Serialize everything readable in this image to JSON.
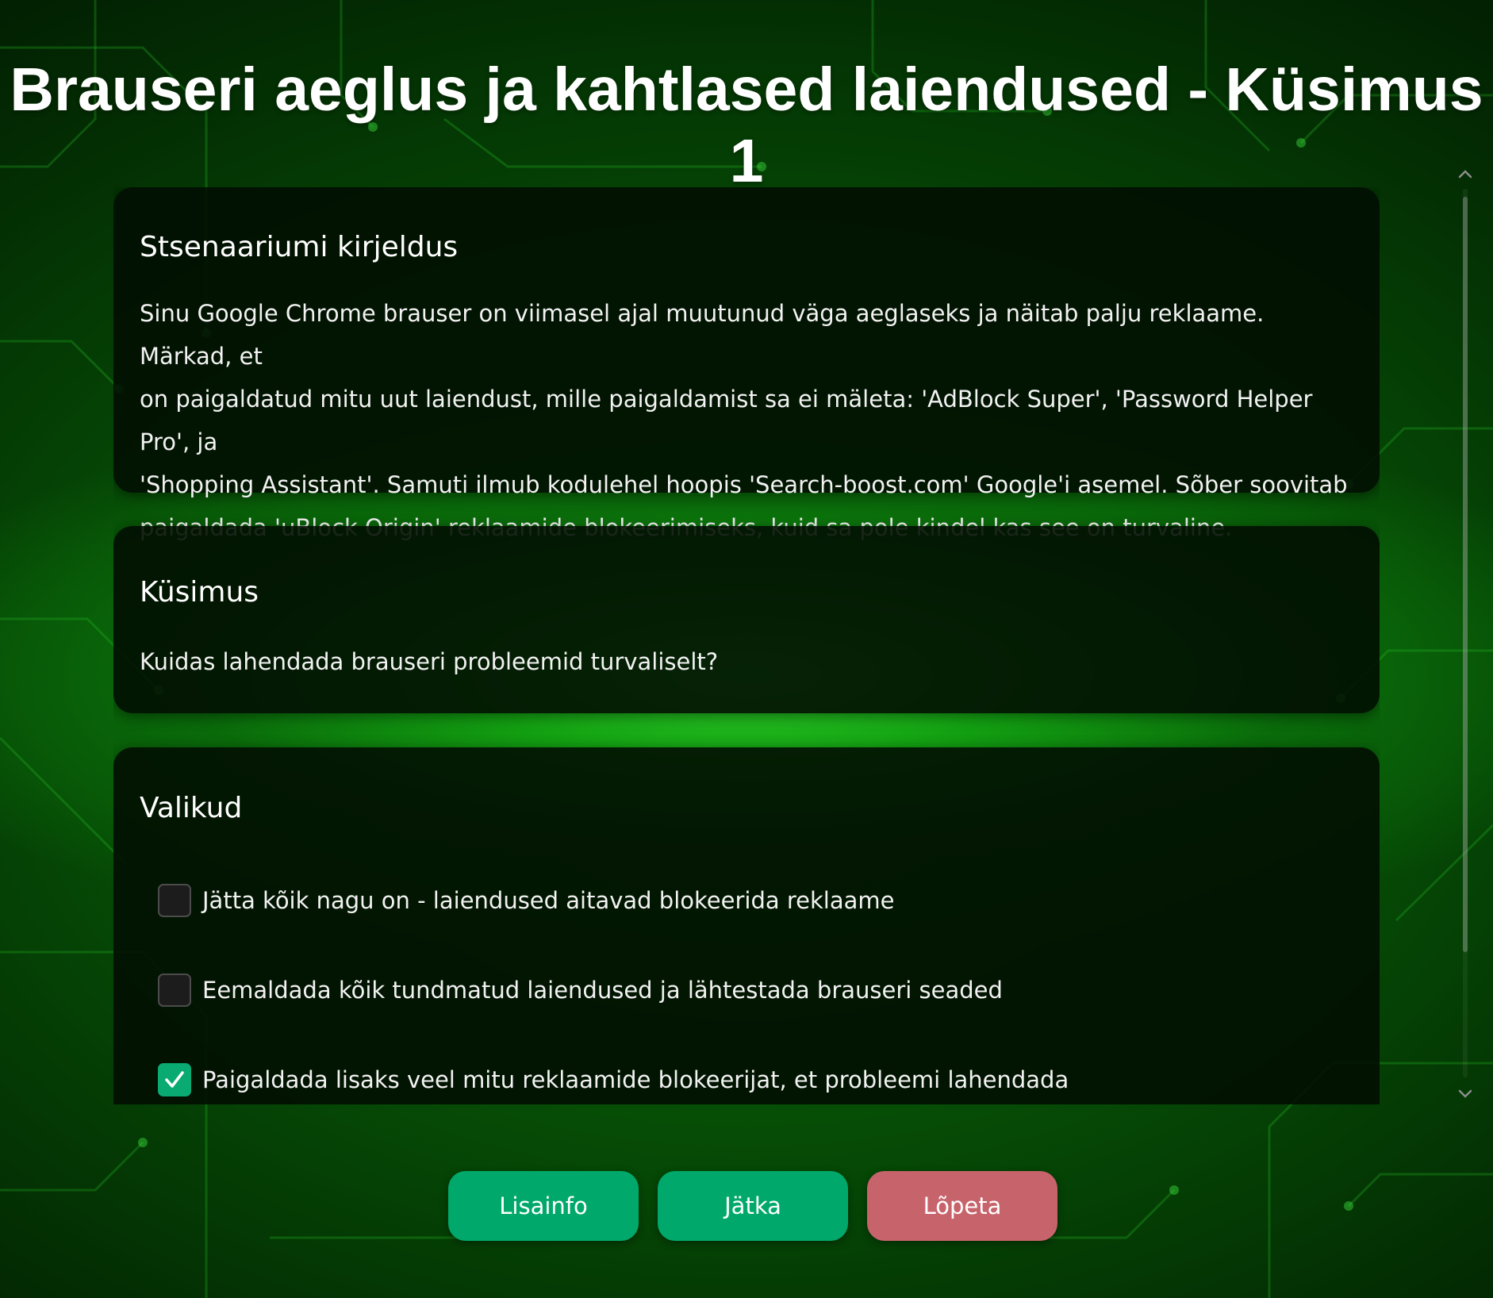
{
  "page": {
    "title": "Brauseri aeglus ja kahtlased laiendused - Küsimus 1"
  },
  "scenario": {
    "heading": "Stsenaariumi kirjeldus",
    "text_lines": [
      "Sinu Google Chrome brauser on viimasel ajal muutunud väga aeglaseks ja näitab palju reklaame. Märkad, et",
      "on paigaldatud mitu uut laiendust, mille paigaldamist sa ei mäleta: 'AdBlock Super', 'Password Helper Pro', ja",
      "'Shopping Assistant'. Samuti ilmub kodulehel hoopis 'Search-boost.com' Google'i asemel. Sõber soovitab",
      "paigaldada 'uBlock Origin' reklaamide blokeerimiseks, kuid sa pole kindel kas see on turvaline."
    ]
  },
  "question": {
    "heading": "Küsimus",
    "text": "Kuidas lahendada brauseri probleemid turvaliselt?"
  },
  "options": {
    "heading": "Valikud",
    "items": [
      {
        "label": "Jätta kõik nagu on - laiendused aitavad blokeerida reklaame",
        "checked": false
      },
      {
        "label": "Eemaldada kõik tundmatud laiendused ja lähtestada brauseri seaded",
        "checked": false
      },
      {
        "label": "Paigaldada lisaks veel mitu reklaamide blokeerijat, et probleemi lahendada",
        "checked": true
      }
    ]
  },
  "buttons": {
    "info": "Lisainfo",
    "continue": "Jätka",
    "quit": "Lõpeta"
  },
  "colors": {
    "primary_button": "#00a96b",
    "quit_button": "#c7636b",
    "checkbox_checked": "#0aaa73",
    "card_background": "#020e02"
  },
  "icons": {
    "scroll_up": "chevron-up-icon",
    "scroll_down": "chevron-down-icon",
    "checkmark": "checkmark-icon"
  }
}
